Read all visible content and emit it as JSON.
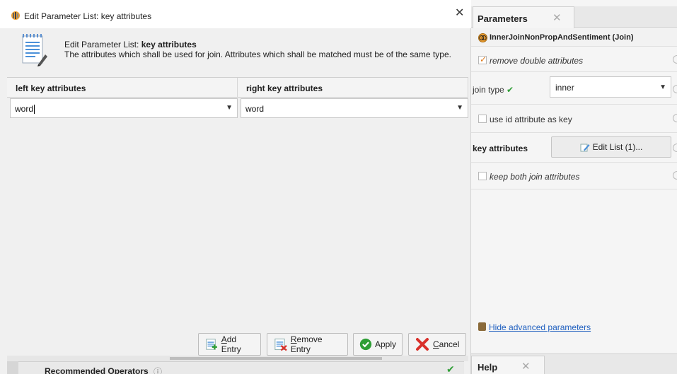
{
  "dialog": {
    "title": "Edit Parameter List: key attributes",
    "header_prefix": "Edit Parameter List: ",
    "header_bold": "key attributes",
    "description": "The attributes which shall be used for join. Attributes which shall be matched must be of the same type.",
    "columns": [
      "left key attributes",
      "right key attributes"
    ],
    "rows": [
      {
        "left": "word",
        "right": "word"
      }
    ],
    "buttons": {
      "add_entry": {
        "mnemonic": "A",
        "rest": "dd Entry"
      },
      "remove_entry": {
        "mnemonic": "R",
        "rest": "emove Entry"
      },
      "apply": "Apply",
      "cancel": {
        "mnemonic": "C",
        "rest": "ancel"
      }
    },
    "recommended_operators": "Recommended Operators"
  },
  "params": {
    "tab_label": "Parameters",
    "operator_name": "InnerJoinNonPropAndSentiment (Join)",
    "remove_double_attributes": {
      "label": "remove double attributes",
      "checked": true
    },
    "join_type": {
      "label": "join type",
      "value": "inner"
    },
    "use_id_attribute": {
      "label": "use id attribute as key",
      "checked": false
    },
    "key_attributes": {
      "label": "key attributes",
      "button": "Edit List (1)..."
    },
    "keep_both": {
      "label": "keep both join attributes",
      "checked": false
    },
    "hide_advanced": "Hide advanced parameters",
    "help_tab": "Help"
  },
  "colors": {
    "accent_green": "#2e9e35",
    "check_orange": "#e07a1a",
    "link_blue": "#1f5fbf"
  }
}
